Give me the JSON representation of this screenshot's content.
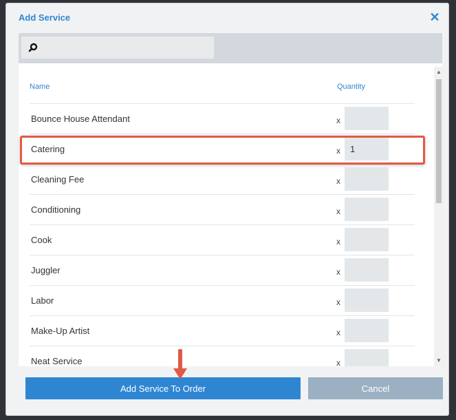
{
  "dialog": {
    "title": "Add Service",
    "close_icon": "close-icon"
  },
  "search": {
    "value": "",
    "placeholder": "",
    "icon": "search-icon"
  },
  "table": {
    "headers": {
      "name": "Name",
      "quantity": "Quantity"
    },
    "multiplier": "x",
    "rows": [
      {
        "name": "Bounce House Attendant",
        "quantity": ""
      },
      {
        "name": "Catering",
        "quantity": "1"
      },
      {
        "name": "Cleaning Fee",
        "quantity": ""
      },
      {
        "name": "Conditioning",
        "quantity": ""
      },
      {
        "name": "Cook",
        "quantity": ""
      },
      {
        "name": "Juggler",
        "quantity": ""
      },
      {
        "name": "Labor",
        "quantity": ""
      },
      {
        "name": "Make-Up Artist",
        "quantity": ""
      },
      {
        "name": "Neat Service",
        "quantity": ""
      }
    ]
  },
  "footer": {
    "add_label": "Add Service To Order",
    "cancel_label": "Cancel"
  },
  "colors": {
    "accent": "#2e86d3",
    "highlight": "#e15a45",
    "cancel": "#9bb0c2"
  }
}
